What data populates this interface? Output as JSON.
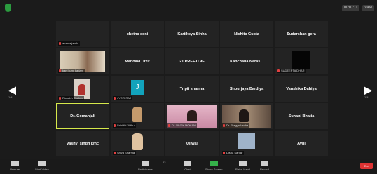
{
  "topbar": {
    "view_label": "View",
    "timer": "00:07:11"
  },
  "nav": {
    "prev_page": "1/4",
    "next_page": "1/4"
  },
  "participants": [
    {
      "name": "",
      "label": "ananta jandu"
    },
    {
      "name": "chetna soni",
      "label": ""
    },
    {
      "name": "Kartikeya Sinha",
      "label": ""
    },
    {
      "name": "Nishita Gupta",
      "label": ""
    },
    {
      "name": "Sudarshan gera",
      "label": ""
    },
    {
      "name": "",
      "label": "kani kumi kadam"
    },
    {
      "name": "Mandavi Dixit",
      "label": ""
    },
    {
      "name": "21 PREETI 9E",
      "label": ""
    },
    {
      "name": "Kanchana Naras...",
      "label": ""
    },
    {
      "name": "",
      "label": "SUDEEPTA DHAR"
    },
    {
      "name": "",
      "label": "Rishabh Chakra"
    },
    {
      "name": "",
      "label": "JYOTI RAJ"
    },
    {
      "name": "Tripti sharma",
      "label": ""
    },
    {
      "name": "Shourjaya Bardiya",
      "label": ""
    },
    {
      "name": "Vanshika Dahiya",
      "label": ""
    },
    {
      "name": "Dr. Gomanjali",
      "label": ""
    },
    {
      "name": "",
      "label": "Srinidhi Vidhu"
    },
    {
      "name": "",
      "label": "Dr. VIVEK MOHAN"
    },
    {
      "name": "",
      "label": "Dr. Pragya Vadha"
    },
    {
      "name": "Suhani Bhatia",
      "label": ""
    },
    {
      "name": "yashvi singh kmc",
      "label": ""
    },
    {
      "name": "",
      "label": "Shiva Sharma"
    },
    {
      "name": "Ujjwal",
      "label": ""
    },
    {
      "name": "",
      "label": "Disha Sardar"
    },
    {
      "name": "Avni",
      "label": ""
    }
  ],
  "toolbar": {
    "unmute": "Unmute",
    "start_video": "Start Video",
    "participants": "Participants",
    "participants_count": "63",
    "chat": "Chat",
    "share_screen": "Share Screen",
    "raise_hand": "Raise Hand",
    "record": "Record",
    "end": "End"
  },
  "colors": {
    "share_screen": "#35b24a",
    "active_speaker": "#d6e84b",
    "end_button": "#dd3333"
  }
}
